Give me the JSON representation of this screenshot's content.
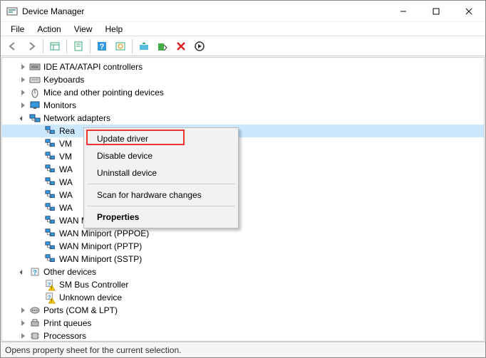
{
  "window": {
    "title": "Device Manager"
  },
  "menus": {
    "file": "File",
    "action": "Action",
    "view": "View",
    "help": "Help"
  },
  "tree": {
    "categories": [
      {
        "icon": "ide",
        "label": "IDE ATA/ATAPI controllers",
        "expanded": false
      },
      {
        "icon": "keyboard",
        "label": "Keyboards",
        "expanded": false
      },
      {
        "icon": "mouse",
        "label": "Mice and other pointing devices",
        "expanded": false
      },
      {
        "icon": "monitor",
        "label": "Monitors",
        "expanded": false
      },
      {
        "icon": "network",
        "label": "Network adapters",
        "expanded": true,
        "children": [
          {
            "label": "Rea",
            "selected": true
          },
          {
            "label": "VM"
          },
          {
            "label": "VM"
          },
          {
            "label": "WA"
          },
          {
            "label": "WA"
          },
          {
            "label": "WA"
          },
          {
            "label": "WA"
          },
          {
            "label": "WAN Miniport (Network Monitor)"
          },
          {
            "label": "WAN Miniport (PPPOE)"
          },
          {
            "label": "WAN Miniport (PPTP)"
          },
          {
            "label": "WAN Miniport (SSTP)"
          }
        ]
      },
      {
        "icon": "other",
        "label": "Other devices",
        "expanded": true,
        "children": [
          {
            "label": "SM Bus Controller",
            "warn": true
          },
          {
            "label": "Unknown device",
            "warn": true
          }
        ]
      },
      {
        "icon": "port",
        "label": "Ports (COM & LPT)",
        "expanded": false
      },
      {
        "icon": "printer",
        "label": "Print queues",
        "expanded": false
      },
      {
        "icon": "cpu",
        "label": "Processors",
        "expanded": false
      }
    ]
  },
  "context_menu": {
    "update": "Update driver",
    "disable": "Disable device",
    "uninstall": "Uninstall device",
    "scan": "Scan for hardware changes",
    "properties": "Properties"
  },
  "status": {
    "text": "Opens property sheet for the current selection."
  }
}
